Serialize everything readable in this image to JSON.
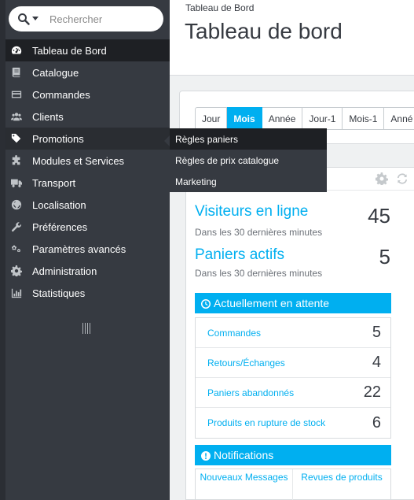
{
  "search": {
    "placeholder": "Rechercher"
  },
  "sidebar": {
    "items": [
      {
        "label": "Tableau de Bord",
        "icon": "dashboard-icon"
      },
      {
        "label": "Catalogue",
        "icon": "book-icon"
      },
      {
        "label": "Commandes",
        "icon": "credit-card-icon"
      },
      {
        "label": "Clients",
        "icon": "users-icon"
      },
      {
        "label": "Promotions",
        "icon": "tags-icon"
      },
      {
        "label": "Modules et Services",
        "icon": "puzzle-icon"
      },
      {
        "label": "Transport",
        "icon": "truck-icon"
      },
      {
        "label": "Localisation",
        "icon": "globe-icon"
      },
      {
        "label": "Préférences",
        "icon": "wrench-icon"
      },
      {
        "label": "Paramètres avancés",
        "icon": "cogs-icon"
      },
      {
        "label": "Administration",
        "icon": "gear-icon"
      },
      {
        "label": "Statistiques",
        "icon": "bar-chart-icon"
      }
    ]
  },
  "flyout": {
    "items": [
      "Règles paniers",
      "Règles de prix catalogue",
      "Marketing"
    ]
  },
  "header": {
    "breadcrumb": "Tableau de Bord",
    "title": "Tableau de bord"
  },
  "tabs": [
    "Jour",
    "Mois",
    "Année",
    "Jour-1",
    "Mois-1",
    "Anné"
  ],
  "activity": {
    "visitors": {
      "title": "Visiteurs en ligne",
      "sub": "Dans les 30 dernières minutes",
      "value": "45"
    },
    "carts": {
      "title": "Paniers actifs",
      "sub": "Dans les 30 dernières minutes",
      "value": "5"
    },
    "pending": {
      "title": "Actuellement en attente",
      "rows": [
        {
          "label": "Commandes",
          "value": "5"
        },
        {
          "label": "Retours/Échanges",
          "value": "4"
        },
        {
          "label": "Paniers abandonnés",
          "value": "22"
        },
        {
          "label": "Produits en rupture de stock",
          "value": "6"
        }
      ]
    },
    "notifications": {
      "title": "Notifications",
      "new_messages": "Nouveaux Messages",
      "reviews": "Revues de produits"
    }
  },
  "colors": {
    "accent": "#00aff0",
    "sidebar": "#363a41"
  }
}
